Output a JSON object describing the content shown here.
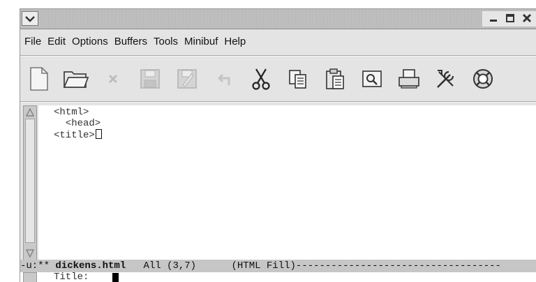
{
  "window": {
    "controls": [
      {
        "name": "minimize-icon"
      },
      {
        "name": "maximize-icon"
      },
      {
        "name": "close-icon"
      }
    ]
  },
  "menubar": {
    "items": [
      "File",
      "Edit",
      "Options",
      "Buffers",
      "Tools",
      "Minibuf",
      "Help"
    ]
  },
  "toolbar": {
    "icons": [
      "new-file-icon",
      "open-folder-icon",
      "close-x-icon",
      "save-icon",
      "save-as-icon",
      "undo-icon",
      "cut-icon",
      "copy-icon",
      "paste-icon",
      "search-icon",
      "print-icon",
      "customize-tools-icon",
      "help-lifebuoy-icon"
    ]
  },
  "editor": {
    "lines": [
      "<html>",
      "  <head>",
      "<title>"
    ]
  },
  "modeline": {
    "prefix": "-u:** ",
    "buffer_name": "dickens.html",
    "position": "   All (3,7)      ",
    "mode": "(HTML Fill)-----------------------------------"
  },
  "minibuffer": {
    "prompt": "Title:"
  }
}
